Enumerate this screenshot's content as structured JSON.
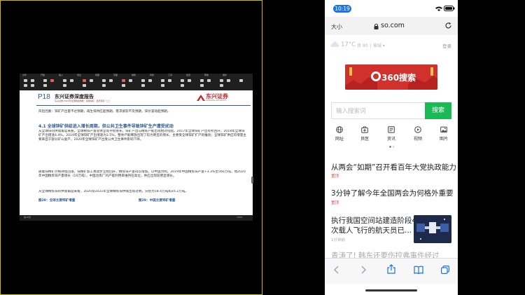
{
  "doc": {
    "toolbar_labels": [
      "文件",
      "开始",
      "插入",
      "批注",
      "视图",
      "页面",
      "编辑",
      "转换",
      "工具",
      "会员",
      "帮助",
      "保护"
    ],
    "page_label": "P18",
    "report_title": "东兴证券深度报告",
    "report_subtitle": "东兴证券 2021年全国两会前瞻：关键指标、经济目标（二）",
    "logo_cn": "东兴证券",
    "logo_en": "DONGXING SECURITIES",
    "para_intro": "风险因素：锌矿产出量不达预期，再生锌供应超预期，需求疲软不及预期，锌价波动超预期。",
    "section_heading": "4.1 全球锌矿供给进入增长周期，但公共卫生事件导致锌矿生产遭受扰动",
    "para1": "从全球锌的供需角度来看，全球精锌产量总体呈现平稳增长，锌矿产出与精炼产能出现相对错配。2017年全球锌矿产出有所回升，2018年全球锌矿产出增速4.4%，2019年全球锌矿产出增速为2.5%，整体产能释放出现了较为明显的增长，主要受全球锌矿扩产的推动；全球锌矿供应的增量主要来自于部分矿山复产，2020年全球锌矿产出受公共卫生事件影响下降。",
    "para2": "随着锌精矿价格持续回落，锌精矿加工费逐步企稳回升，精炼锌产量得以增加。以中国为例，2019年中国精炼锌产量+3.3%至560万吨，而2020年中国精炼锌产量增长（10万吨），中国冶炼厂的产能利用率维持在高位，供应出现较明显增长。",
    "para3": "从全球精炼锌的供需角度来看，2020及2021年全球精炼锌供需出现过剩，分别为18.4万吨和20.2万吨。",
    "fig28": "图28：全球主要锌矿增量",
    "fig29": "图29：中国主要锌矿增量",
    "status_left": "第18页",
    "status_right": "100%"
  },
  "phone": {
    "time": "10:19",
    "text_size": "大小",
    "url": "so.com",
    "weather_temp": "17°C",
    "weather_sub": "良 80 │ 榆城 ▾",
    "login": "登录",
    "banner_text": "360搜索",
    "search_placeholder": "输入搜索词",
    "search_button": "搜索",
    "quicknav": [
      {
        "label": "网址",
        "icon": "globe-icon"
      },
      {
        "label": "良医",
        "icon": "medical-kit-icon"
      },
      {
        "label": "资讯",
        "icon": "news-icon"
      },
      {
        "label": "视频",
        "icon": "video-icon"
      },
      {
        "label": "图片",
        "icon": "image-icon"
      }
    ],
    "news": [
      {
        "title": "从两会“如期”召开看百年大党执政能力",
        "tag": "置顶"
      },
      {
        "title": "3分钟了解今年全国两会为何格外重要",
        "tag": "置顶"
      },
      {
        "title_line1": "执行我国空间站建造阶段4",
        "title_line2": "次载人飞行的航天员已...",
        "time": "1分钟前"
      },
      {
        "title": "青涛了! 韩东还要伤控弗事件经过"
      }
    ]
  },
  "colors": {
    "accent_green": "#19b955",
    "banner_red": "#d0312d",
    "time_pill": "#1a73e8",
    "doc_blue": "#2b5a92",
    "tag_red": "#e6453c"
  }
}
